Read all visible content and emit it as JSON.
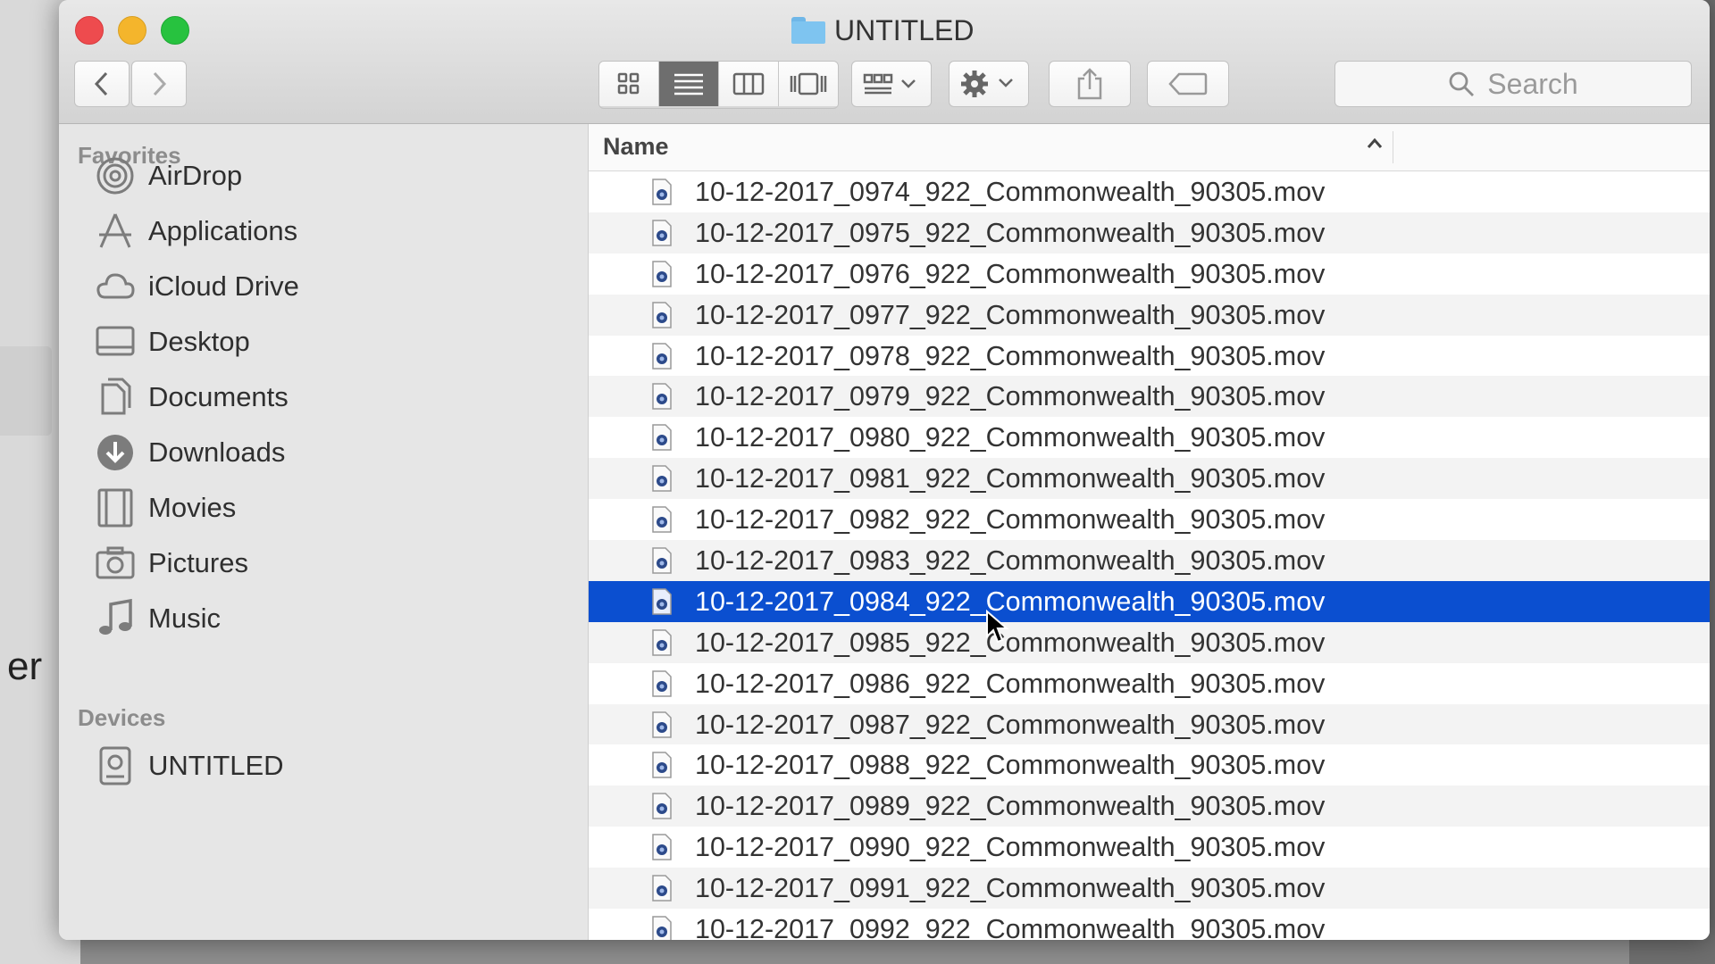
{
  "window": {
    "title": "UNTITLED"
  },
  "background": {
    "partial_text": "er"
  },
  "toolbar": {
    "search_placeholder": "Search",
    "view_buttons": [
      "icon",
      "list",
      "column",
      "cover-flow"
    ],
    "active_view": "list"
  },
  "sidebar": {
    "favorites_heading": "Favorites",
    "favorites": [
      {
        "label": "AirDrop",
        "icon": "airdrop-icon"
      },
      {
        "label": "Applications",
        "icon": "applications-icon"
      },
      {
        "label": "iCloud Drive",
        "icon": "cloud-icon"
      },
      {
        "label": "Desktop",
        "icon": "desktop-icon"
      },
      {
        "label": "Documents",
        "icon": "documents-icon"
      },
      {
        "label": "Downloads",
        "icon": "downloads-icon"
      },
      {
        "label": "Movies",
        "icon": "movies-icon"
      },
      {
        "label": "Pictures",
        "icon": "camera-icon"
      },
      {
        "label": "Music",
        "icon": "music-icon"
      }
    ],
    "devices_heading": "Devices",
    "devices": [
      {
        "label": "UNTITLED",
        "icon": "disk-icon"
      }
    ]
  },
  "list": {
    "column_header": "Name",
    "selected_index": 10,
    "files": [
      "10-12-2017_0974_922_Commonwealth_90305.mov",
      "10-12-2017_0975_922_Commonwealth_90305.mov",
      "10-12-2017_0976_922_Commonwealth_90305.mov",
      "10-12-2017_0977_922_Commonwealth_90305.mov",
      "10-12-2017_0978_922_Commonwealth_90305.mov",
      "10-12-2017_0979_922_Commonwealth_90305.mov",
      "10-12-2017_0980_922_Commonwealth_90305.mov",
      "10-12-2017_0981_922_Commonwealth_90305.mov",
      "10-12-2017_0982_922_Commonwealth_90305.mov",
      "10-12-2017_0983_922_Commonwealth_90305.mov",
      "10-12-2017_0984_922_Commonwealth_90305.mov",
      "10-12-2017_0985_922_Commonwealth_90305.mov",
      "10-12-2017_0986_922_Commonwealth_90305.mov",
      "10-12-2017_0987_922_Commonwealth_90305.mov",
      "10-12-2017_0988_922_Commonwealth_90305.mov",
      "10-12-2017_0989_922_Commonwealth_90305.mov",
      "10-12-2017_0990_922_Commonwealth_90305.mov",
      "10-12-2017_0991_922_Commonwealth_90305.mov",
      "10-12-2017_0992_922_Commonwealth_90305.mov"
    ]
  },
  "colors": {
    "selection": "#0b4fd0",
    "close": "#ee4b4e",
    "minimize": "#f4b52c",
    "maximize": "#27c23f"
  }
}
